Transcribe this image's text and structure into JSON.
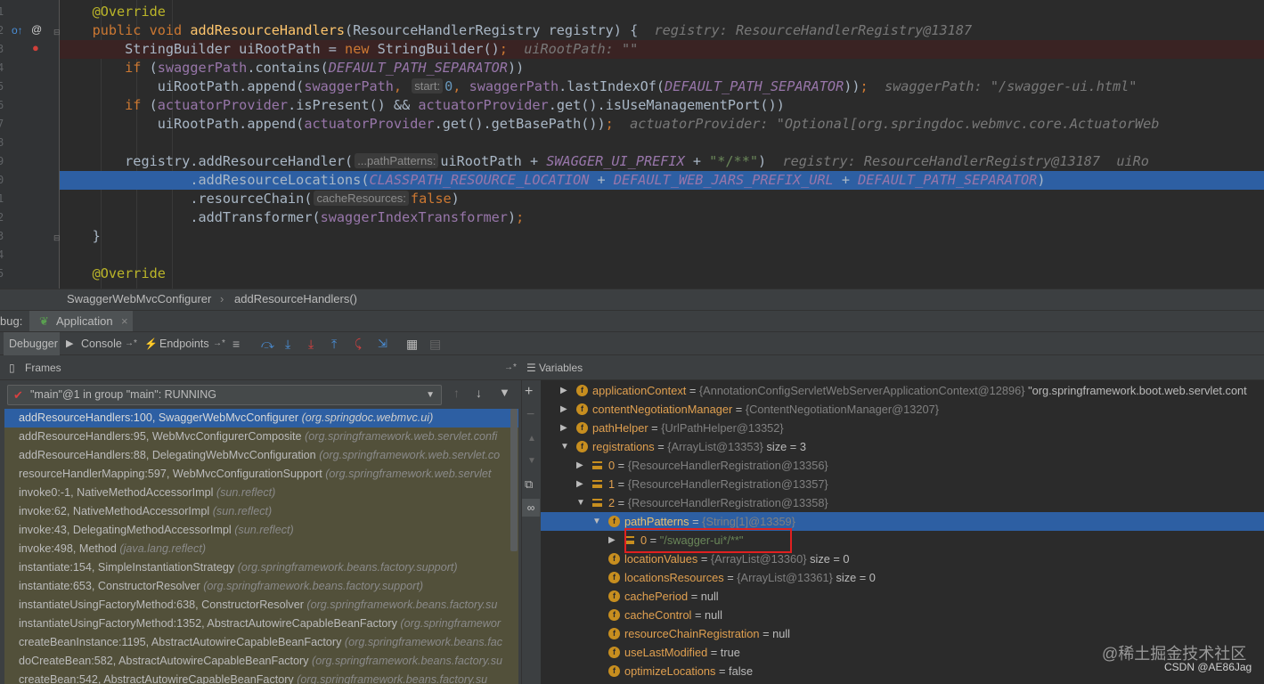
{
  "editor": {
    "line_numbers": [
      "1",
      "2",
      "3",
      "4",
      "5",
      "6",
      "7",
      "8",
      "9",
      "0",
      "1",
      "2",
      "3",
      "4",
      "5"
    ],
    "lines": [
      {
        "indent": "    ",
        "tokens": [
          [
            "ann",
            "@Override"
          ]
        ]
      },
      {
        "indent": "    ",
        "tokens": [
          [
            "kw",
            "public void "
          ],
          [
            "mth",
            "addResourceHandlers"
          ],
          [
            "",
            "(ResourceHandlerRegistry registry) {  "
          ],
          [
            "hint",
            "registry: ResourceHandlerRegistry@13187"
          ]
        ]
      },
      {
        "indent": "        ",
        "tokens": [
          [
            "",
            "StringBuilder uiRootPath = "
          ],
          [
            "kw",
            "new "
          ],
          [
            "",
            "StringBuilder()"
          ],
          [
            "kw",
            ";  "
          ],
          [
            "hint",
            "uiRootPath: \"\""
          ]
        ]
      },
      {
        "indent": "        ",
        "tokens": [
          [
            "kw",
            "if "
          ],
          [
            "",
            "("
          ],
          [
            "fld",
            "swaggerPath"
          ],
          [
            "",
            ".contains("
          ],
          [
            "cst",
            "DEFAULT_PATH_SEPARATOR"
          ],
          [
            "",
            "))"
          ]
        ]
      },
      {
        "indent": "            ",
        "tokens": [
          [
            "",
            "uiRootPath.append("
          ],
          [
            "fld",
            "swaggerPath"
          ],
          [
            "kw",
            ", "
          ],
          [
            "ph",
            "start:"
          ],
          [
            "num",
            "0"
          ],
          [
            "kw",
            ", "
          ],
          [
            "fld",
            "swaggerPath"
          ],
          [
            "",
            ".lastIndexOf("
          ],
          [
            "cst",
            "DEFAULT_PATH_SEPARATOR"
          ],
          [
            "",
            "))"
          ],
          [
            "kw",
            ";  "
          ],
          [
            "hint",
            "swaggerPath: \"/swagger-ui.html\""
          ]
        ]
      },
      {
        "indent": "        ",
        "tokens": [
          [
            "kw",
            "if "
          ],
          [
            "",
            "("
          ],
          [
            "fld",
            "actuatorProvider"
          ],
          [
            "",
            ".isPresent() && "
          ],
          [
            "fld",
            "actuatorProvider"
          ],
          [
            "",
            ".get().isUseManagementPort())"
          ]
        ]
      },
      {
        "indent": "            ",
        "tokens": [
          [
            "",
            "uiRootPath.append("
          ],
          [
            "fld",
            "actuatorProvider"
          ],
          [
            "",
            ".get().getBasePath())"
          ],
          [
            "kw",
            ";  "
          ],
          [
            "hint",
            "actuatorProvider: \"Optional[org.springdoc.webmvc.core.ActuatorWeb"
          ]
        ]
      },
      {
        "indent": "",
        "tokens": []
      },
      {
        "indent": "        ",
        "tokens": [
          [
            "",
            "registry.addResourceHandler("
          ],
          [
            "ph",
            "...pathPatterns:"
          ],
          [
            "",
            "uiRootPath + "
          ],
          [
            "cst",
            "SWAGGER_UI_PREFIX"
          ],
          [
            "",
            " + "
          ],
          [
            "str",
            "\"*/**\""
          ],
          [
            "",
            ")  "
          ],
          [
            "hint",
            "registry: ResourceHandlerRegistry@13187  uiRo"
          ]
        ]
      },
      {
        "indent": "                ",
        "tokens": [
          [
            "",
            ".addResourceLocations("
          ],
          [
            "cst",
            "CLASSPATH_RESOURCE_LOCATION"
          ],
          [
            "",
            " + "
          ],
          [
            "cst",
            "DEFAULT_WEB_JARS_PREFIX_URL"
          ],
          [
            "",
            " + "
          ],
          [
            "cst",
            "DEFAULT_PATH_SEPARATOR"
          ],
          [
            "",
            ")"
          ]
        ]
      },
      {
        "indent": "                ",
        "tokens": [
          [
            "",
            ".resourceChain("
          ],
          [
            "ph",
            "cacheResources:"
          ],
          [
            "kw",
            "false"
          ],
          [
            "",
            ")"
          ]
        ]
      },
      {
        "indent": "                ",
        "tokens": [
          [
            "",
            ".addTransformer("
          ],
          [
            "fld",
            "swaggerIndexTransformer"
          ],
          [
            "",
            ")"
          ],
          [
            "kw",
            ";"
          ]
        ]
      },
      {
        "indent": "    ",
        "tokens": [
          [
            "",
            "}"
          ]
        ]
      },
      {
        "indent": "",
        "tokens": []
      },
      {
        "indent": "    ",
        "tokens": [
          [
            "ann",
            "@Override"
          ]
        ]
      }
    ]
  },
  "breadcrumb": {
    "class_name": "SwaggerWebMvcConfigurer",
    "separator": "›",
    "method_name": "addResourceHandlers()"
  },
  "debug_tabs": {
    "prefix": "bug:",
    "tab_label": "Application",
    "close": "×"
  },
  "toolbar": {
    "debugger_tab": "Debugger",
    "console_tab": "Console",
    "endpoints_tab": "Endpoints",
    "console_pin": "→*",
    "endpoints_pin": "→*"
  },
  "frames": {
    "title": "Frames",
    "pin": "→*",
    "thread": "\"main\"@1 in group \"main\": RUNNING",
    "items": [
      {
        "m": "addResourceHandlers:100, SwaggerWebMvcConfigurer",
        "p": "(org.springdoc.webmvc.ui)"
      },
      {
        "m": "addResourceHandlers:95, WebMvcConfigurerComposite",
        "p": "(org.springframework.web.servlet.confi"
      },
      {
        "m": "addResourceHandlers:88, DelegatingWebMvcConfiguration",
        "p": "(org.springframework.web.servlet.co"
      },
      {
        "m": "resourceHandlerMapping:597, WebMvcConfigurationSupport",
        "p": "(org.springframework.web.servlet"
      },
      {
        "m": "invoke0:-1, NativeMethodAccessorImpl",
        "p": "(sun.reflect)"
      },
      {
        "m": "invoke:62, NativeMethodAccessorImpl",
        "p": "(sun.reflect)"
      },
      {
        "m": "invoke:43, DelegatingMethodAccessorImpl",
        "p": "(sun.reflect)"
      },
      {
        "m": "invoke:498, Method",
        "p": "(java.lang.reflect)"
      },
      {
        "m": "instantiate:154, SimpleInstantiationStrategy",
        "p": "(org.springframework.beans.factory.support)"
      },
      {
        "m": "instantiate:653, ConstructorResolver",
        "p": "(org.springframework.beans.factory.support)"
      },
      {
        "m": "instantiateUsingFactoryMethod:638, ConstructorResolver",
        "p": "(org.springframework.beans.factory.su"
      },
      {
        "m": "instantiateUsingFactoryMethod:1352, AbstractAutowireCapableBeanFactory",
        "p": "(org.springframewor"
      },
      {
        "m": "createBeanInstance:1195, AbstractAutowireCapableBeanFactory",
        "p": "(org.springframework.beans.fac"
      },
      {
        "m": "doCreateBean:582, AbstractAutowireCapableBeanFactory",
        "p": "(org.springframework.beans.factory.su"
      },
      {
        "m": "createBean:542, AbstractAutowireCapableBeanFactory",
        "p": "(org.springframework.beans.factory.su"
      }
    ]
  },
  "variables": {
    "title": "Variables",
    "items": [
      {
        "depth": 0,
        "arrow": "▶",
        "icon": "f",
        "name": "applicationContext",
        "ref": "{AnnotationConfigServletWebServerApplicationContext@12896}",
        "extra": " \"org.springframework.boot.web.servlet.cont"
      },
      {
        "depth": 0,
        "arrow": "▶",
        "icon": "f",
        "name": "contentNegotiationManager",
        "ref": "{ContentNegotiationManager@13207}",
        "extra": ""
      },
      {
        "depth": 0,
        "arrow": "▶",
        "icon": "f",
        "name": "pathHelper",
        "ref": "{UrlPathHelper@13352}",
        "extra": ""
      },
      {
        "depth": 0,
        "arrow": "▼",
        "icon": "f",
        "name": "registrations",
        "ref": "{ArrayList@13353}",
        "extra": "  size = 3"
      },
      {
        "depth": 1,
        "arrow": "▶",
        "icon": "l",
        "name": "0",
        "ref": "{ResourceHandlerRegistration@13356}",
        "extra": ""
      },
      {
        "depth": 1,
        "arrow": "▶",
        "icon": "l",
        "name": "1",
        "ref": "{ResourceHandlerRegistration@13357}",
        "extra": ""
      },
      {
        "depth": 1,
        "arrow": "▼",
        "icon": "l",
        "name": "2",
        "ref": "{ResourceHandlerRegistration@13358}",
        "extra": ""
      },
      {
        "depth": 2,
        "arrow": "▼",
        "icon": "f",
        "name": "pathPatterns",
        "ref": "{String[1]@13359}",
        "extra": "",
        "sel": true
      },
      {
        "depth": 3,
        "arrow": "▶",
        "icon": "l",
        "name": "0",
        "ref": "\"/swagger-ui*/**\"",
        "extra": "",
        "str": true
      },
      {
        "depth": 2,
        "arrow": "",
        "icon": "f",
        "name": "locationValues",
        "ref": "{ArrayList@13360}",
        "extra": "  size = 0"
      },
      {
        "depth": 2,
        "arrow": "",
        "icon": "f",
        "name": "locationsResources",
        "ref": "{ArrayList@13361}",
        "extra": "  size = 0"
      },
      {
        "depth": 2,
        "arrow": "",
        "icon": "f",
        "name": "cachePeriod",
        "ref": "",
        "extra": "null"
      },
      {
        "depth": 2,
        "arrow": "",
        "icon": "f",
        "name": "cacheControl",
        "ref": "",
        "extra": "null"
      },
      {
        "depth": 2,
        "arrow": "",
        "icon": "f",
        "name": "resourceChainRegistration",
        "ref": "",
        "extra": "null"
      },
      {
        "depth": 2,
        "arrow": "",
        "icon": "f",
        "name": "useLastModified",
        "ref": "",
        "extra": "true"
      },
      {
        "depth": 2,
        "arrow": "",
        "icon": "f",
        "name": "optimizeLocations",
        "ref": "",
        "extra": "false"
      }
    ]
  },
  "watermark": {
    "line1": "@稀土掘金技术社区",
    "line2": "CSDN @AE86Jag"
  },
  "colors": {
    "selection": "#2d5fa3",
    "highlight_box": "#e02020"
  }
}
